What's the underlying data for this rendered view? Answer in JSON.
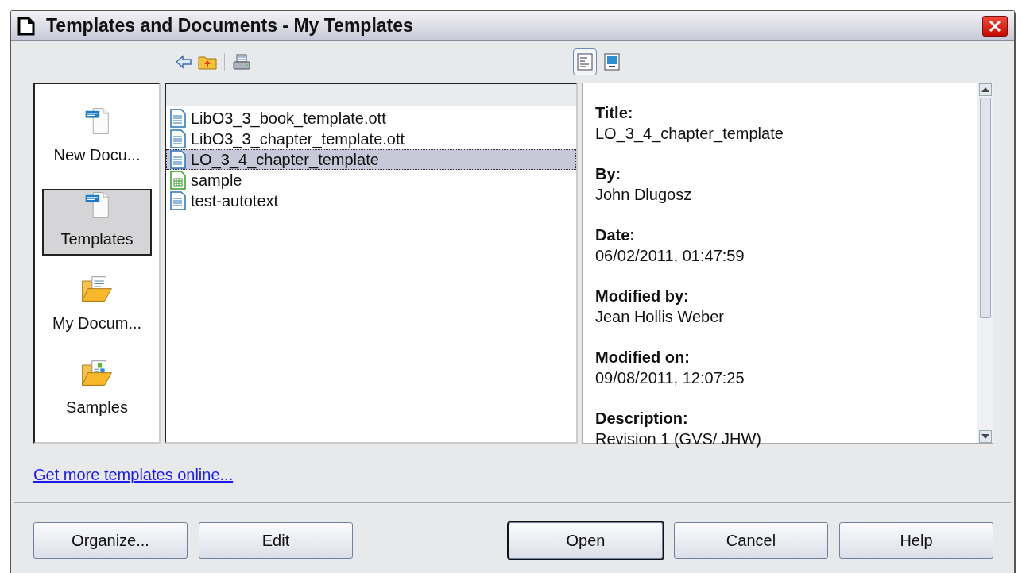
{
  "window": {
    "title": "Templates and Documents - My Templates"
  },
  "toolbar": {
    "view_modes": [
      {
        "kind": "details",
        "selected": true
      },
      {
        "kind": "preview",
        "selected": false
      }
    ]
  },
  "sidebar": {
    "items": [
      {
        "label": "New Docu...",
        "kind": "odf",
        "selected": false
      },
      {
        "label": "Templates",
        "kind": "odf",
        "selected": true
      },
      {
        "label": "My Docum...",
        "kind": "folder",
        "selected": false
      },
      {
        "label": "Samples",
        "kind": "folder-samples",
        "selected": false
      }
    ]
  },
  "files": [
    {
      "name": "LibO3_3_book_template.ott",
      "kind": "text",
      "selected": false
    },
    {
      "name": "LibO3_3_chapter_template.ott",
      "kind": "text",
      "selected": false
    },
    {
      "name": "LO_3_4_chapter_template",
      "kind": "text",
      "selected": true
    },
    {
      "name": "sample",
      "kind": "spreadsheet",
      "selected": false
    },
    {
      "name": "test-autotext",
      "kind": "text",
      "selected": false
    }
  ],
  "properties": [
    {
      "label": "Title:",
      "value": "LO_3_4_chapter_template"
    },
    {
      "label": "By:",
      "value": "John Dlugosz"
    },
    {
      "label": "Date:",
      "value": "06/02/2011, 01:47:59"
    },
    {
      "label": "Modified by:",
      "value": "Jean Hollis Weber"
    },
    {
      "label": "Modified on:",
      "value": "09/08/2011, 12:07:25"
    },
    {
      "label": "Description:",
      "value": "Revision 1 (GVS/ JHW)"
    }
  ],
  "link": "Get more templates online...",
  "buttons": [
    {
      "label": "Organize...",
      "default": false
    },
    {
      "label": "Edit",
      "default": false
    },
    {
      "label": "Open",
      "default": true
    },
    {
      "label": "Cancel",
      "default": false
    },
    {
      "label": "Help",
      "default": false
    }
  ]
}
